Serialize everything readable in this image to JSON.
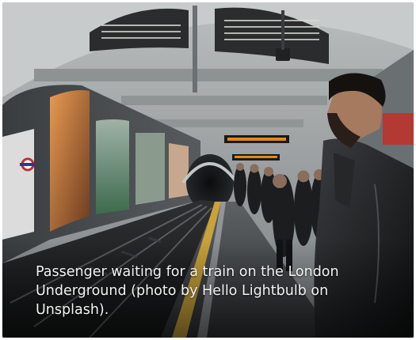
{
  "photo": {
    "caption": "Passenger waiting for a train on the London Underground (photo by Hello Lightbulb on Unsplash)."
  }
}
